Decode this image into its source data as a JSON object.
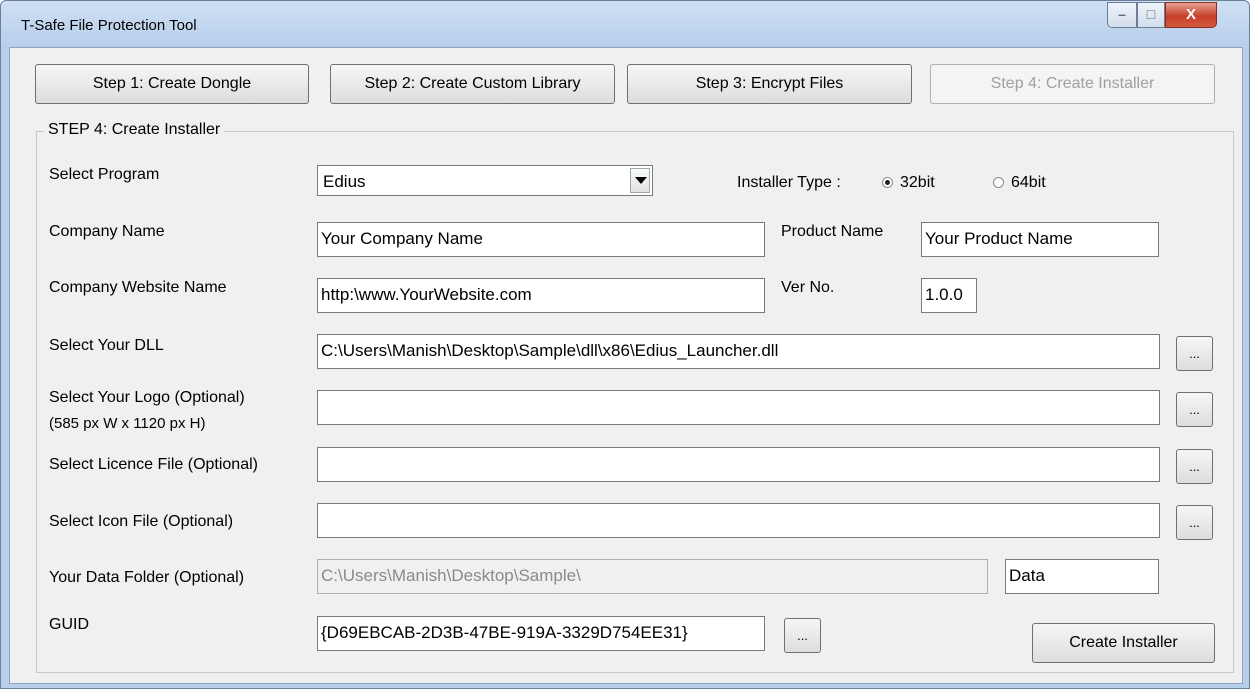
{
  "window": {
    "title": "T-Safe File Protection Tool",
    "minimize": "–",
    "maximize": "□",
    "close": "X"
  },
  "steps": [
    {
      "label": "Step 1: Create Dongle",
      "enabled": true
    },
    {
      "label": "Step 2: Create Custom Library",
      "enabled": true
    },
    {
      "label": "Step 3: Encrypt Files",
      "enabled": true
    },
    {
      "label": "Step 4: Create Installer",
      "enabled": false
    }
  ],
  "group": {
    "title": "STEP 4: Create Installer"
  },
  "form": {
    "select_program": {
      "label": "Select Program",
      "value": "Edius"
    },
    "installer_type": {
      "label": "Installer Type :",
      "options": [
        "32bit",
        "64bit"
      ],
      "selected": "32bit"
    },
    "company_name": {
      "label": "Company Name",
      "value": "Your Company Name"
    },
    "product_name": {
      "label": "Product Name",
      "value": "Your Product Name"
    },
    "company_website": {
      "label": "Company Website Name",
      "value": "http:\\www.YourWebsite.com"
    },
    "version": {
      "label": "Ver No.",
      "value": "1.0.0"
    },
    "dll": {
      "label": "Select Your DLL",
      "value": "C:\\Users\\Manish\\Desktop\\Sample\\dll\\x86\\Edius_Launcher.dll",
      "browse": "..."
    },
    "logo": {
      "label": "Select Your Logo (Optional)",
      "hint": "(585 px W x 1120 px H)",
      "value": "",
      "browse": "..."
    },
    "licence": {
      "label": "Select Licence File (Optional)",
      "value": "",
      "browse": "..."
    },
    "icon": {
      "label": "Select Icon File (Optional)",
      "value": "",
      "browse": "..."
    },
    "data_folder": {
      "label": "Your Data Folder (Optional)",
      "path": "C:\\Users\\Manish\\Desktop\\Sample\\",
      "name": "Data"
    },
    "guid": {
      "label": "GUID",
      "value": "{D69EBCAB-2D3B-47BE-919A-3329D754EE31}",
      "browse": "..."
    }
  },
  "create_button": "Create Installer"
}
